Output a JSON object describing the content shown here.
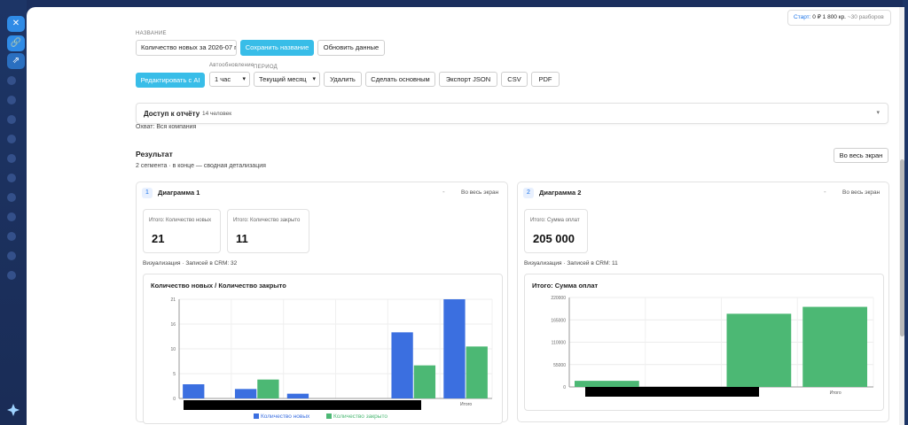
{
  "topbar": {
    "start_label": "Старт:",
    "balance": "0 ₽",
    "credits": "1 800 кр.",
    "remaining": "~30 разборов"
  },
  "report": {
    "name_label": "НАЗВАНИЕ",
    "name_value": "Количество новых за 2026-07 п",
    "save_name_label": "Сохранить название",
    "refresh_label": "Обновить данные",
    "edit_ai_label": "Редактировать с AI",
    "autoupdate_label": "Автообновление",
    "autoupdate_value": "1 час",
    "period_label": "ПЕРИОД",
    "period_value": "Текущий месяц",
    "delete_label": "Удалить",
    "make_main_label": "Сделать основным",
    "export_json_label": "Экспорт JSON",
    "csv_label": "CSV",
    "pdf_label": "PDF"
  },
  "access": {
    "title": "Доступ к отчёту",
    "count": "14 человек",
    "scope": "Охват: Вся компания"
  },
  "result": {
    "title": "Результат",
    "subtitle": "2 сегмента · в конце — сводная детализация",
    "fullscreen_label": "Во весь экран"
  },
  "diagram1": {
    "number": "1",
    "title": "Диаграмма 1",
    "fullscreen_label": "Во весь экран",
    "metrics": [
      {
        "label": "Итого: Количество новых",
        "value": "21"
      },
      {
        "label": "Итого: Количество закрыто",
        "value": "11"
      }
    ],
    "viz_label": "Визуализация",
    "records": "Записей в CRM: 32"
  },
  "diagram2": {
    "number": "2",
    "title": "Диаграмма 2",
    "fullscreen_label": "Во весь экран",
    "metrics": [
      {
        "label": "Итого: Сумма оплат",
        "value": "205 000"
      }
    ],
    "viz_label": "Визуализация",
    "records": "Записей в CRM: 11"
  },
  "chart_data": [
    {
      "type": "bar",
      "title": "Количество новых / Количество закрыто",
      "categories": [
        "",
        "",
        "",
        "",
        "",
        "Итого"
      ],
      "series": [
        {
          "name": "Количество новых",
          "color": "#3b6fe0",
          "values": [
            3,
            2,
            1,
            0,
            14,
            21
          ]
        },
        {
          "name": "Количество закрыто",
          "color": "#4cb874",
          "values": [
            0,
            4,
            0,
            0,
            7,
            11
          ]
        }
      ],
      "yticks": [
        "0",
        "5",
        "10",
        "16",
        "21"
      ],
      "ylim": [
        0,
        21
      ],
      "legend": "bottom",
      "grid": true
    },
    {
      "type": "bar",
      "title": "Итого: Сумма оплат",
      "categories": [
        "",
        "",
        "",
        "Итого"
      ],
      "series": [
        {
          "name": "Сумма оплат",
          "color": "#4cb874",
          "values": [
            15000,
            0,
            180000,
            197000
          ]
        }
      ],
      "yticks": [
        "0",
        "55000",
        "110000",
        "165000",
        "220000"
      ],
      "ylim": [
        0,
        220000
      ],
      "grid": true
    }
  ]
}
